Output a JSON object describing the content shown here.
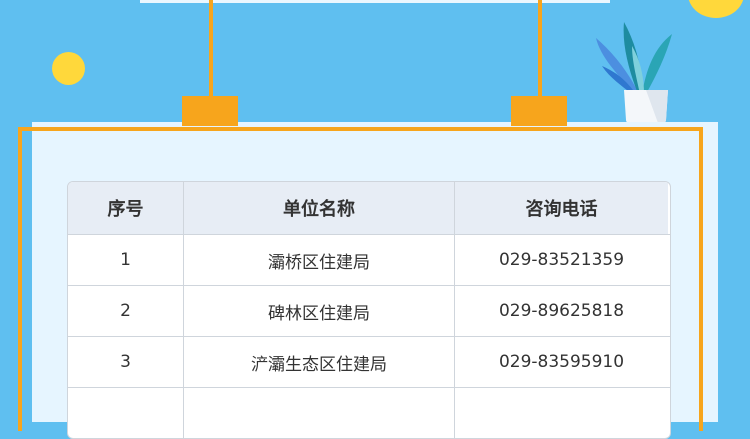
{
  "table": {
    "headers": [
      "序号",
      "单位名称",
      "咨询电话"
    ],
    "rows": [
      [
        "1",
        "灞桥区住建局",
        "029-83521359"
      ],
      [
        "2",
        "碑林区住建局",
        "029-89625818"
      ],
      [
        "3",
        "浐灞生态区住建局",
        "029-83595910"
      ],
      [
        "",
        "",
        ""
      ]
    ]
  }
}
